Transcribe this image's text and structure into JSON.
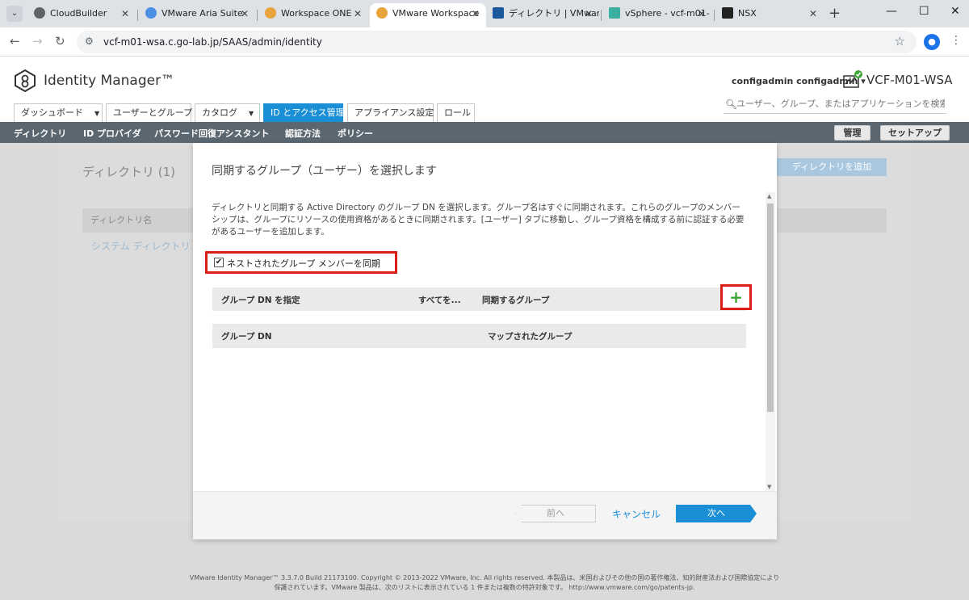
{
  "browser": {
    "tabs": [
      {
        "title": "CloudBuilder",
        "favicon_color": "#5f6368"
      },
      {
        "title": "VMware Aria Suite",
        "favicon_color": "#4a90e2"
      },
      {
        "title": "Workspace ONE",
        "favicon_color": "#e8a33c"
      },
      {
        "title": "VMware Workspace",
        "favicon_color": "#e8a33c"
      },
      {
        "title": "ディレクトリ | VMware",
        "favicon_color": "#1d5a9c"
      },
      {
        "title": "vSphere - vcf-m01-",
        "favicon_color": "#3bb0a0"
      },
      {
        "title": "NSX",
        "favicon_color": "#222222"
      }
    ],
    "url": "vcf-m01-wsa.c.go-lab.jp/SAAS/admin/identity"
  },
  "header": {
    "app_name": "Identity Manager™",
    "user_menu": "configadmin configadmin ▾",
    "tenant": "VCF-M01-WSA",
    "search_placeholder": "ユーザー、グループ、またはアプリケーションを検索"
  },
  "main_tabs": [
    {
      "label": "ダッシュボード",
      "caret": "▼"
    },
    {
      "label": "ユーザーとグループ",
      "caret": ""
    },
    {
      "label": "カタログ",
      "caret": "▼"
    },
    {
      "label": "ID とアクセス管理",
      "caret": ""
    },
    {
      "label": "アプライアンス設定",
      "caret": ""
    },
    {
      "label": "ロール",
      "caret": ""
    }
  ],
  "subnav": {
    "items": [
      "ディレクトリ",
      "ID プロバイダ",
      "パスワード回復アシスタント",
      "認証方法",
      "ポリシー"
    ],
    "manage_label": "管理",
    "setup_label": "セットアップ"
  },
  "background_page": {
    "title": "ディレクトリ (1)",
    "add_button": "ディレクトリを追加",
    "column_header": "ディレクトリ名",
    "row_link": "システム ディレクトリ"
  },
  "modal": {
    "title": "同期するグループ（ユーザー）を選択します",
    "description": "ディレクトリと同期する Active Directory のグループ DN を選択します。グループ名はすぐに同期されます。これらのグループのメンバーシップは、グループにリソースの使用資格があるときに同期されます。[ユーザー] タブに移動し、グループ資格を構成する前に認証する必要があるユーザーを追加します。",
    "checkbox_label": "ネストされたグループ メンバーを同期",
    "checkbox_checked": true,
    "grid1_columns": [
      "グループ DN を指定",
      "すべてを...",
      "同期するグループ"
    ],
    "grid2_columns": [
      "グループ DN",
      "マップされたグループ"
    ],
    "add_icon": "+",
    "buttons": {
      "back": "前へ",
      "cancel": "キャンセル",
      "next": "次へ"
    }
  },
  "footer": {
    "line1": "VMware Identity Manager™ 3.3.7.0 Build 21173100. Copyright © 2013-2022 VMware, Inc. All rights reserved. 本製品は、米国およびその他の国の著作権法、知的財産法および国際協定により",
    "line2": "保護されています。VMware 製品は、次のリストに表示されている 1 件または複数の特許対象です。 http://www.vmware.com/go/patents-jp."
  }
}
